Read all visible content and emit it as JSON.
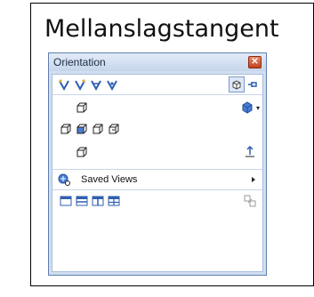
{
  "caption": "Mellanslagstangent",
  "panel": {
    "title": "Orientation",
    "close_label": "✕",
    "saved_views_label": "Saved Views"
  },
  "colors": {
    "panel_bg": "#d2def0",
    "titlebar": "#c6d5ec",
    "close_btn": "#c2401e",
    "icon_blue": "#2f5fb0"
  },
  "icons": {
    "toolbar_row": [
      "view-selector-icon-1",
      "view-selector-icon-2",
      "view-selector-icon-3",
      "view-selector-icon-4",
      "view-cube-toggle-icon",
      "pin-icon"
    ],
    "standard_views": [
      "top-view-icon",
      "left-view-icon",
      "front-view-icon",
      "right-view-icon",
      "back-view-icon",
      "bottom-view-icon",
      "isometric-view-icon",
      "normal-to-icon"
    ],
    "viewport_row": [
      "single-viewport-icon",
      "two-viewport-horizontal-icon",
      "two-viewport-vertical-icon",
      "four-viewport-icon",
      "link-views-icon"
    ]
  }
}
